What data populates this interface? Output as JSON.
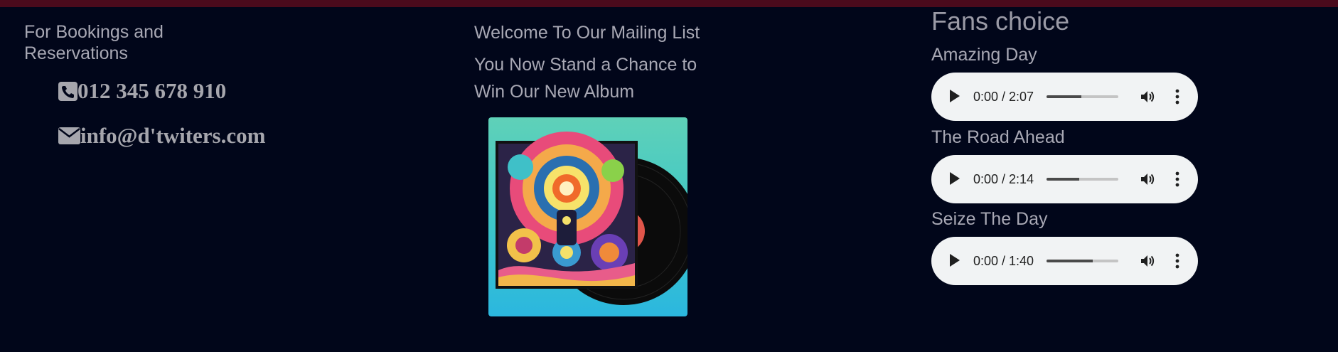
{
  "contact": {
    "heading": "For Bookings and Reservations",
    "phone": "012 345 678 910",
    "email": "info@d'twiters.com"
  },
  "mailing": {
    "heading": "Welcome To Our Mailing List",
    "subtext": "You Now Stand a Chance to Win Our New Album"
  },
  "fans": {
    "title": "Fans choice",
    "tracks": [
      {
        "title": "Amazing Day",
        "time": "0:00 / 2:07",
        "progress_fraction": 0.49
      },
      {
        "title": "The Road Ahead",
        "time": "0:00 / 2:14",
        "progress_fraction": 0.46
      },
      {
        "title": "Seize The Day",
        "time": "0:00 / 1:40",
        "progress_fraction": 0.64
      }
    ]
  },
  "icons": {
    "phone": "phone-square-icon",
    "email": "envelope-icon",
    "play": "play-icon",
    "volume": "volume-icon",
    "more": "more-vertical-icon"
  },
  "colors": {
    "background": "#01061a",
    "topbar": "#4a0a1c",
    "text": "#a8a8b4",
    "player_bg": "#f1f3f4"
  }
}
